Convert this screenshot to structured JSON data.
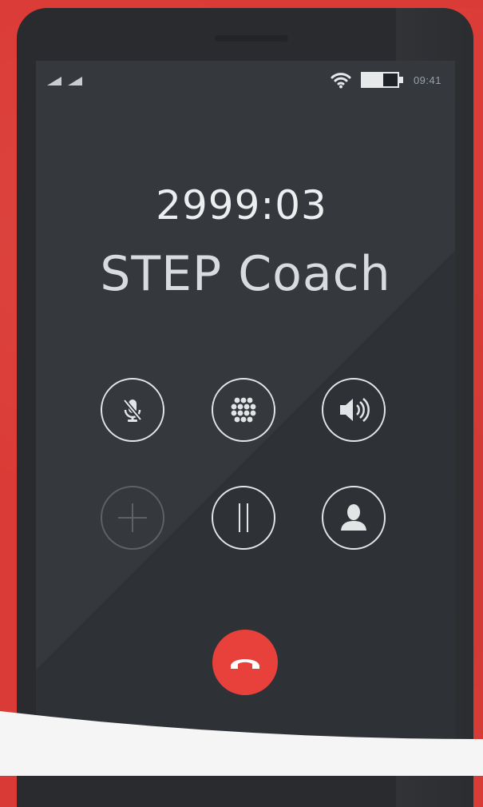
{
  "status_bar": {
    "time": "09:41",
    "icons": [
      "signal-icon",
      "signal-icon",
      "wifi-icon",
      "battery-icon"
    ]
  },
  "call": {
    "timer": "2999:03",
    "caller_name": "STEP Coach"
  },
  "controls": {
    "row1": [
      "mute-mic-icon",
      "keypad-icon",
      "speaker-icon"
    ],
    "row2": [
      "add-call-icon",
      "hold-icon",
      "contact-icon"
    ],
    "end_call": "end-call-icon"
  },
  "colors": {
    "background": "#db3b36",
    "screen": "#2e3237",
    "end_call": "#e8413b",
    "button_stroke": "#e2e4e6",
    "disabled_stroke": "#5e6267"
  }
}
